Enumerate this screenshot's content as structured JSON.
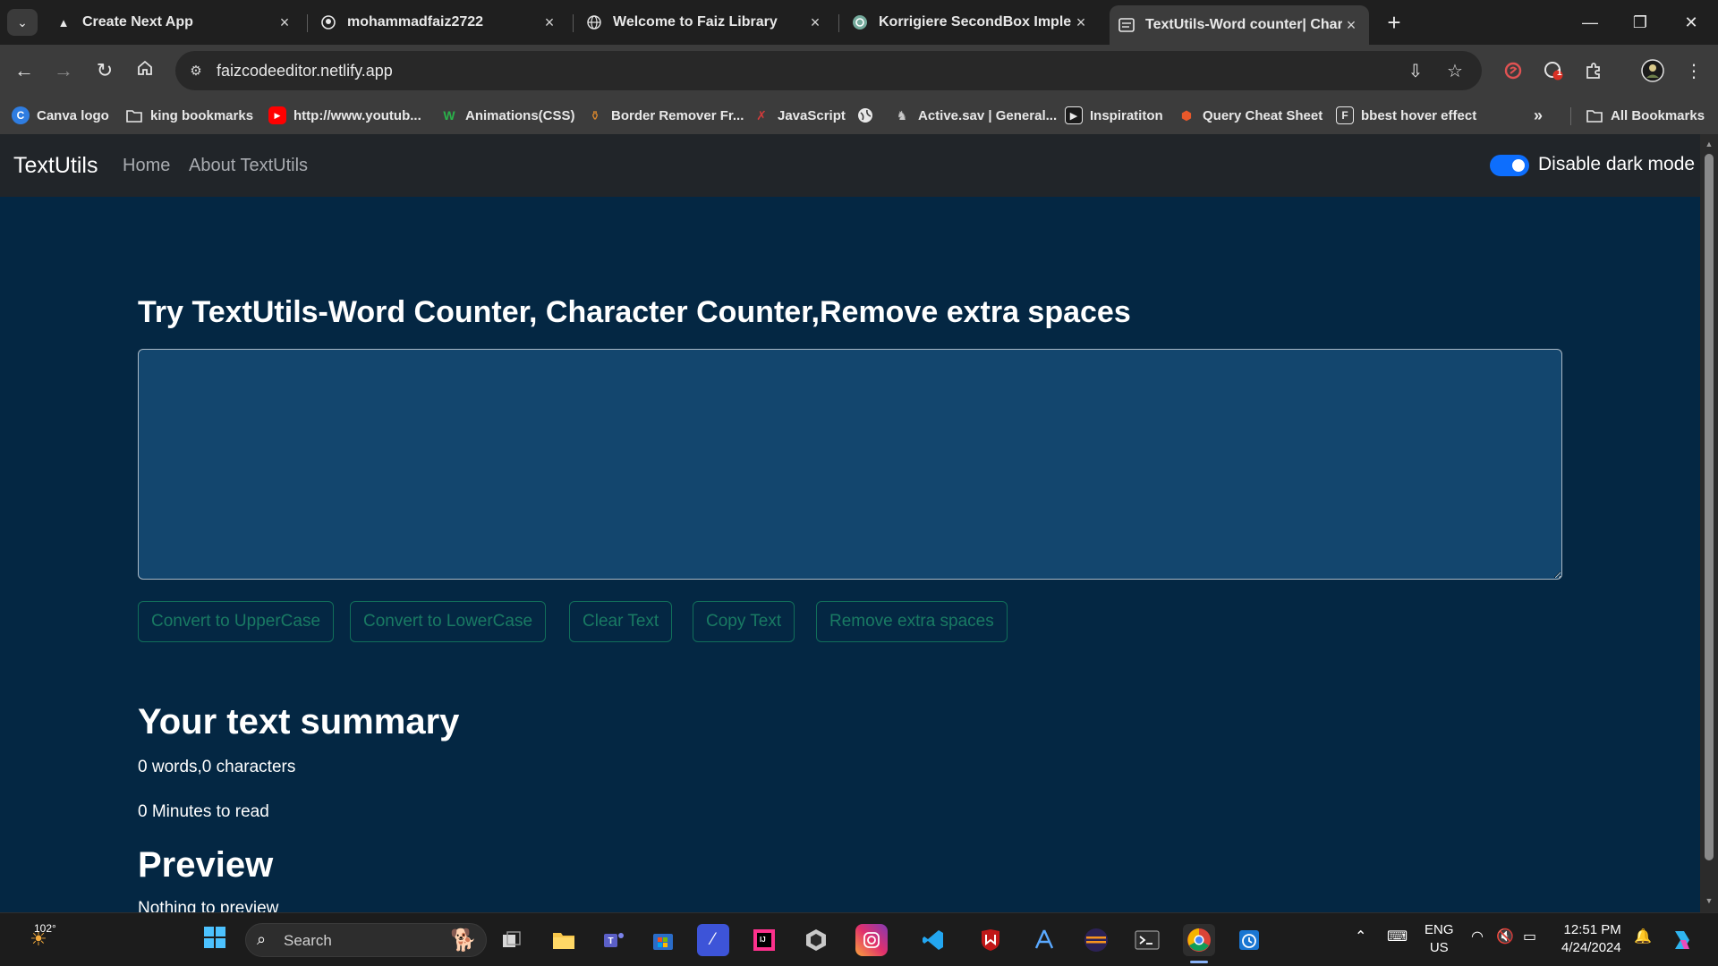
{
  "tabs": [
    {
      "title": "Create Next App",
      "icon": "triangle-icon"
    },
    {
      "title": "mohammadfaiz2722",
      "icon": "github-icon"
    },
    {
      "title": "Welcome to Faiz Library",
      "icon": "globe-icon"
    },
    {
      "title": "Korrigiere SecondBox Impleme",
      "icon": "chatgpt-icon"
    },
    {
      "title": "TextUtils-Word counter| Chara",
      "icon": "page-icon",
      "active": true
    }
  ],
  "address_bar": {
    "url": "faizcodeeditor.netlify.app"
  },
  "bookmarks": [
    {
      "label": "Canva logo",
      "icon": "canva-icon"
    },
    {
      "label": "king bookmarks",
      "icon": "folder-icon"
    },
    {
      "label": "http://www.youtub...",
      "icon": "youtube-icon"
    },
    {
      "label": "Animations(CSS)",
      "icon": "w-icon"
    },
    {
      "label": "Border Remover Fr...",
      "icon": "bottle-icon"
    },
    {
      "label": "JavaScript",
      "icon": "x-icon"
    },
    {
      "label": "",
      "icon": "globe-icon"
    },
    {
      "label": "Active.sav | General...",
      "icon": "creature-icon"
    },
    {
      "label": "Inspiratiton",
      "icon": "play-icon"
    },
    {
      "label": "Query Cheat Sheet",
      "icon": "shield-icon"
    },
    {
      "label": "bbest hover effect",
      "icon": "f-icon"
    }
  ],
  "all_bookmarks_label": "All Bookmarks",
  "navbar": {
    "brand": "TextUtils",
    "links": [
      "Home",
      "About TextUtils"
    ],
    "toggle_label": "Disable dark mode",
    "toggle_on": true
  },
  "main": {
    "heading": "Try TextUtils-Word Counter, Character Counter,Remove extra spaces",
    "textarea_value": "",
    "buttons": [
      "Convert to UpperCase",
      "Convert to LowerCase",
      "Clear Text",
      "Copy Text",
      "Remove extra spaces"
    ],
    "summary_heading": "Your text summary",
    "summary_counts": "0 words,0 characters",
    "summary_read_time": "0 Minutes to read",
    "preview_heading": "Preview",
    "preview_text": "Nothing to preview"
  },
  "taskbar": {
    "weather_temp": "102°",
    "search_label": "Search",
    "language_line1": "ENG",
    "language_line2": "US",
    "time": "12:51 PM",
    "date": "4/24/2024",
    "extension_badge": "1"
  },
  "colors": {
    "page_bg": "#042743",
    "textarea_bg": "#13466e",
    "navbar_bg": "#212529",
    "button_text": "#197a63",
    "toggle_on": "#0d6efd"
  }
}
